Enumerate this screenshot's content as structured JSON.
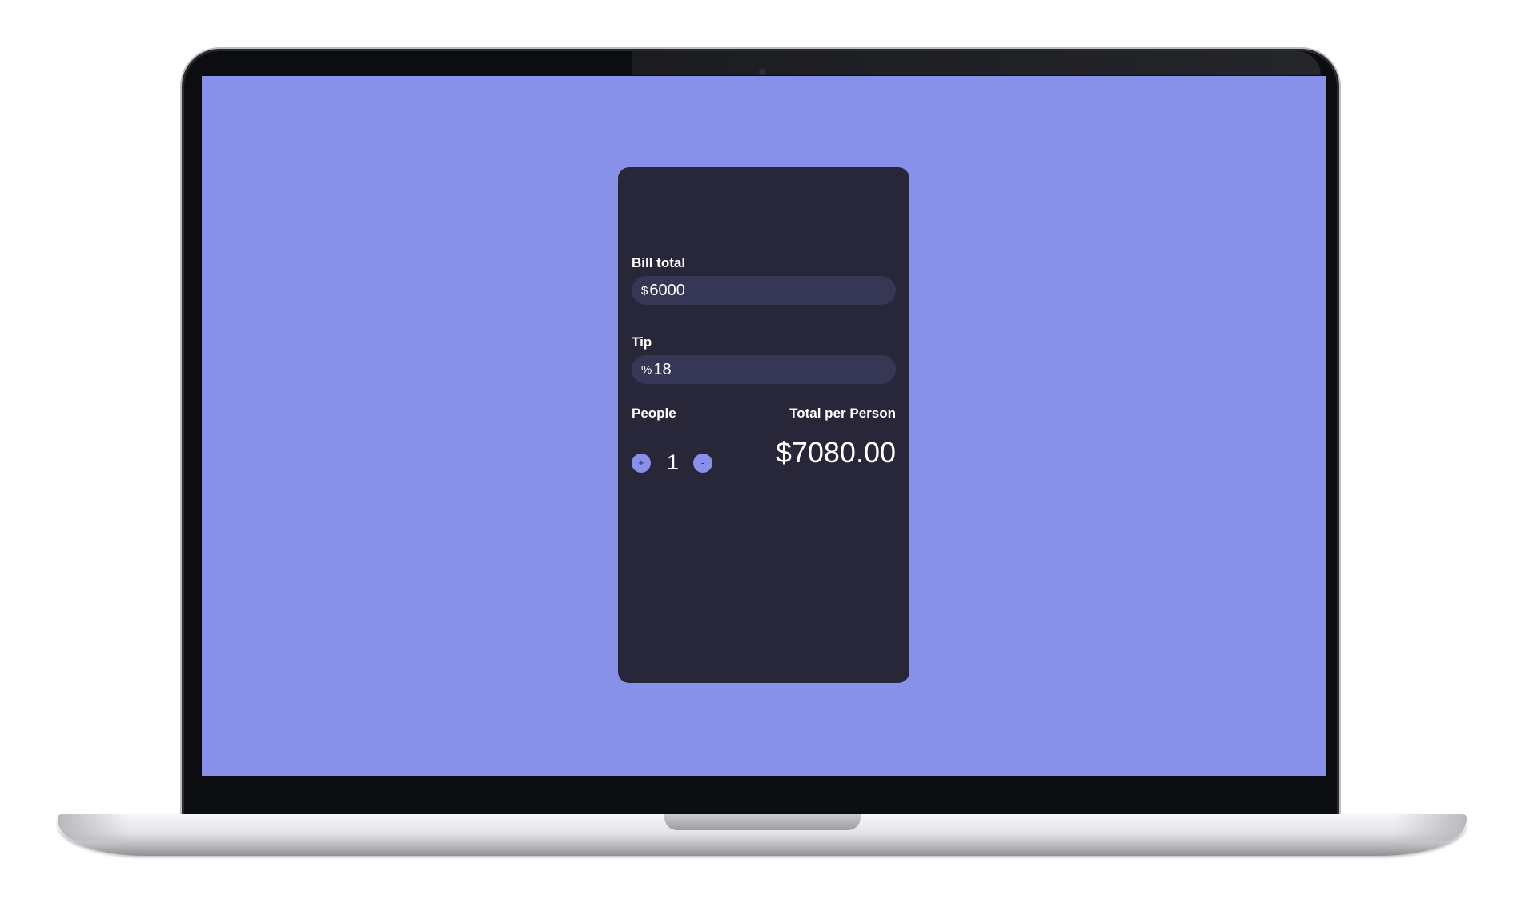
{
  "app": {
    "background_color": "#8990ea",
    "card_color": "#282739",
    "field_color": "#353755"
  },
  "bill": {
    "label": "Bill total",
    "prefix": "$",
    "value": "6000"
  },
  "tip": {
    "label": "Tip",
    "prefix": "%",
    "value": "18"
  },
  "people": {
    "label": "People",
    "increment_symbol": "+",
    "count": "1",
    "decrement_symbol": "-"
  },
  "result": {
    "label": "Total per Person",
    "value": "$7080.00"
  }
}
